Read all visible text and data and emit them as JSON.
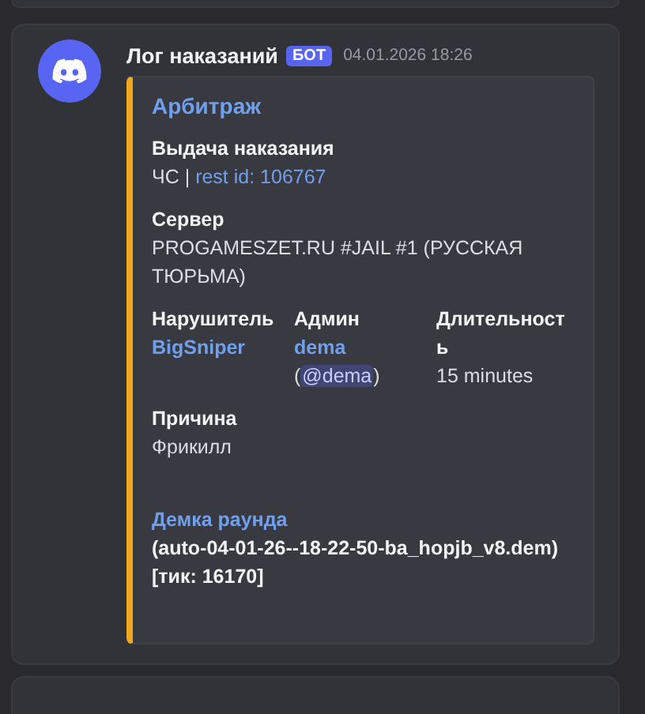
{
  "message": {
    "author": "Лог наказаний",
    "badge": "БОТ",
    "timestamp": "04.01.2026 18:26",
    "embed": {
      "title": "Арбитраж",
      "fields": [
        {
          "name": "Выдача наказания",
          "name_link": false,
          "inline": false,
          "lines": [
            [
              {
                "kind": "text",
                "text": "ЧС | "
              },
              {
                "kind": "link",
                "text": "rest id: 106767"
              }
            ]
          ]
        },
        {
          "name": "Сервер",
          "name_link": false,
          "inline": false,
          "lines": [
            [
              {
                "kind": "text",
                "text": "PROGAMESZET.RU #JAIL #1 (РУССКАЯ ТЮРЬМА)"
              }
            ]
          ]
        },
        {
          "name": "Нарушитель",
          "name_link": false,
          "inline": true,
          "lines": [
            [
              {
                "kind": "bold-link",
                "text": "BigSniper"
              }
            ]
          ]
        },
        {
          "name": "Админ",
          "name_link": false,
          "inline": true,
          "lines": [
            [
              {
                "kind": "bold-link",
                "text": "dema"
              }
            ],
            [
              {
                "kind": "text",
                "text": "("
              },
              {
                "kind": "mention",
                "text": "@dema"
              },
              {
                "kind": "text",
                "text": ")"
              }
            ]
          ]
        },
        {
          "name": "Длительность",
          "name_link": false,
          "inline": true,
          "lines": [
            [
              {
                "kind": "text",
                "text": "15 minutes"
              }
            ]
          ]
        },
        {
          "name": "Причина",
          "name_link": false,
          "inline": false,
          "lines": [
            [
              {
                "kind": "text",
                "text": "Фрикилл"
              }
            ]
          ]
        },
        {
          "name": "Демка раунда",
          "name_link": true,
          "inline": false,
          "lines": [
            [
              {
                "kind": "bold",
                "text": "(auto-04-01-26--18-22-50-ba_hopjb_v8.dem) [тик: 16170]"
              }
            ]
          ]
        }
      ]
    }
  }
}
